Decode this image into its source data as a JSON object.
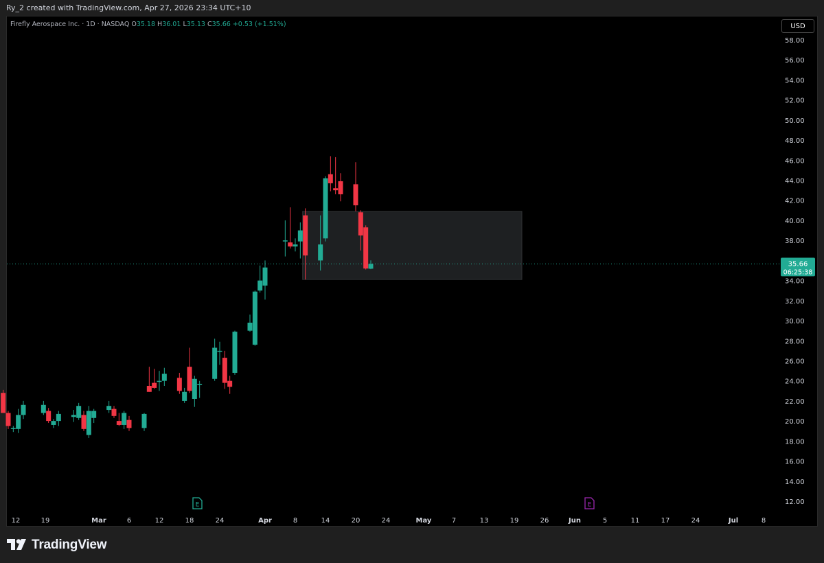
{
  "header": {
    "attribution": "Ry_2 created with TradingView.com, Apr 27, 2026 23:34 UTC+10"
  },
  "legend": {
    "symbol": "Firefly Aerospace Inc. · 1D · NASDAQ",
    "o_label": "O",
    "o": "35.18",
    "h_label": "H",
    "h": "36.01",
    "l_label": "L",
    "l": "35.13",
    "c_label": "C",
    "c": "35.66",
    "change": "+0.53 (+1.51%)"
  },
  "currency_button": "USD",
  "price_tag": {
    "price": "35.66",
    "countdown": "06:25:38"
  },
  "earnings_markers": [
    {
      "label": "E",
      "color": "#22ab94"
    },
    {
      "label": "E",
      "color": "#9c27b0"
    }
  ],
  "brand": {
    "name": "TradingView"
  },
  "colors": {
    "up": "#22ab94",
    "down": "#f23645",
    "background": "#000000",
    "price_line": "#22ab94"
  },
  "chart_data": {
    "type": "candlestick",
    "symbol": "Firefly Aerospace Inc.",
    "interval": "1D",
    "exchange": "NASDAQ",
    "ylim": [
      11,
      60
    ],
    "yticks": [
      "58.00",
      "56.00",
      "54.00",
      "52.00",
      "50.00",
      "48.00",
      "46.00",
      "44.00",
      "42.00",
      "40.00",
      "38.00",
      "36.00",
      "34.00",
      "32.00",
      "30.00",
      "28.00",
      "26.00",
      "24.00",
      "22.00",
      "20.00",
      "18.00",
      "16.00",
      "14.00",
      "12.00"
    ],
    "xticks": [
      "12",
      "19",
      "Mar",
      "6",
      "12",
      "18",
      "24",
      "Apr",
      "8",
      "14",
      "20",
      "24",
      "May",
      "7",
      "13",
      "19",
      "26",
      "Jun",
      "5",
      "11",
      "17",
      "24",
      "Jul",
      "8"
    ],
    "candles": [
      {
        "date": "2026-02-09",
        "o": 22.8,
        "h": 23.1,
        "l": 20.8,
        "c": 20.8
      },
      {
        "date": "2026-02-10",
        "o": 20.8,
        "h": 21.0,
        "l": 19.2,
        "c": 19.5
      },
      {
        "date": "2026-02-11",
        "o": 19.2,
        "h": 19.5,
        "l": 18.9,
        "c": 19.3
      },
      {
        "date": "2026-02-12",
        "o": 19.2,
        "h": 21.2,
        "l": 18.8,
        "c": 20.6
      },
      {
        "date": "2026-02-13",
        "o": 20.6,
        "h": 22.0,
        "l": 20.2,
        "c": 21.6
      },
      {
        "date": "2026-02-17",
        "o": 20.8,
        "h": 22.0,
        "l": 20.6,
        "c": 21.6
      },
      {
        "date": "2026-02-18",
        "o": 21.0,
        "h": 21.3,
        "l": 19.8,
        "c": 20.0
      },
      {
        "date": "2026-02-19",
        "o": 19.6,
        "h": 20.2,
        "l": 19.3,
        "c": 20.0
      },
      {
        "date": "2026-02-20",
        "o": 20.0,
        "h": 21.0,
        "l": 19.5,
        "c": 20.7
      },
      {
        "date": "2026-02-23",
        "o": 20.4,
        "h": 21.1,
        "l": 19.9,
        "c": 20.6
      },
      {
        "date": "2026-02-24",
        "o": 20.3,
        "h": 21.8,
        "l": 20.1,
        "c": 21.5
      },
      {
        "date": "2026-02-25",
        "o": 20.6,
        "h": 21.0,
        "l": 19.0,
        "c": 19.2
      },
      {
        "date": "2026-02-26",
        "o": 18.6,
        "h": 21.5,
        "l": 18.3,
        "c": 21.0
      },
      {
        "date": "2026-02-27",
        "o": 20.3,
        "h": 21.2,
        "l": 19.8,
        "c": 21.0
      },
      {
        "date": "2026-03-02",
        "o": 21.1,
        "h": 22.0,
        "l": 20.8,
        "c": 21.5
      },
      {
        "date": "2026-03-03",
        "o": 21.2,
        "h": 21.5,
        "l": 20.3,
        "c": 20.5
      },
      {
        "date": "2026-03-04",
        "o": 20.0,
        "h": 20.8,
        "l": 19.5,
        "c": 19.6
      },
      {
        "date": "2026-03-05",
        "o": 19.6,
        "h": 21.0,
        "l": 19.2,
        "c": 20.8
      },
      {
        "date": "2026-03-06",
        "o": 20.1,
        "h": 20.5,
        "l": 19.0,
        "c": 19.3
      },
      {
        "date": "2026-03-09",
        "o": 19.3,
        "h": 20.8,
        "l": 19.0,
        "c": 20.7
      },
      {
        "date": "2026-03-10",
        "o": 23.5,
        "h": 25.4,
        "l": 22.9,
        "c": 22.9
      },
      {
        "date": "2026-03-11",
        "o": 23.8,
        "h": 25.2,
        "l": 23.2,
        "c": 23.3
      },
      {
        "date": "2026-03-12",
        "o": 23.9,
        "h": 25.0,
        "l": 23.0,
        "c": 24.0
      },
      {
        "date": "2026-03-13",
        "o": 24.0,
        "h": 25.3,
        "l": 23.5,
        "c": 24.7
      },
      {
        "date": "2026-03-16",
        "o": 24.3,
        "h": 24.8,
        "l": 22.7,
        "c": 23.0
      },
      {
        "date": "2026-03-17",
        "o": 22.0,
        "h": 23.3,
        "l": 21.8,
        "c": 22.9
      },
      {
        "date": "2026-03-18",
        "o": 25.4,
        "h": 27.3,
        "l": 22.8,
        "c": 23.0
      },
      {
        "date": "2026-03-19",
        "o": 22.2,
        "h": 24.5,
        "l": 21.4,
        "c": 24.2
      },
      {
        "date": "2026-03-20",
        "o": 23.6,
        "h": 24.0,
        "l": 22.3,
        "c": 23.7
      },
      {
        "date": "2026-03-23",
        "o": 24.2,
        "h": 28.2,
        "l": 24.0,
        "c": 27.3
      },
      {
        "date": "2026-03-24",
        "o": 27.0,
        "h": 27.9,
        "l": 25.6,
        "c": 27.0
      },
      {
        "date": "2026-03-25",
        "o": 26.3,
        "h": 27.0,
        "l": 23.2,
        "c": 23.8
      },
      {
        "date": "2026-03-26",
        "o": 24.0,
        "h": 24.5,
        "l": 22.7,
        "c": 23.4
      },
      {
        "date": "2026-03-27",
        "o": 24.8,
        "h": 29.0,
        "l": 24.6,
        "c": 28.9
      },
      {
        "date": "2026-03-30",
        "o": 29.0,
        "h": 30.6,
        "l": 28.9,
        "c": 29.8
      },
      {
        "date": "2026-03-31",
        "o": 27.6,
        "h": 33.0,
        "l": 27.5,
        "c": 32.9
      },
      {
        "date": "2026-04-01",
        "o": 33.0,
        "h": 35.5,
        "l": 32.8,
        "c": 34.0
      },
      {
        "date": "2026-04-02",
        "o": 33.5,
        "h": 36.0,
        "l": 32.1,
        "c": 35.3
      },
      {
        "date": "2026-04-06",
        "o": 38.0,
        "h": 40.0,
        "l": 36.4,
        "c": 38.0
      },
      {
        "date": "2026-04-07",
        "o": 37.8,
        "h": 41.3,
        "l": 37.2,
        "c": 37.4
      },
      {
        "date": "2026-04-08",
        "o": 37.4,
        "h": 38.2,
        "l": 36.9,
        "c": 37.6
      },
      {
        "date": "2026-04-09",
        "o": 37.9,
        "h": 39.8,
        "l": 36.2,
        "c": 39.0
      },
      {
        "date": "2026-04-10",
        "o": 40.5,
        "h": 41.2,
        "l": 34.1,
        "c": 36.5
      },
      {
        "date": "2026-04-13",
        "o": 36.0,
        "h": 40.5,
        "l": 35.0,
        "c": 37.6
      },
      {
        "date": "2026-04-14",
        "o": 38.2,
        "h": 44.4,
        "l": 37.9,
        "c": 44.2
      },
      {
        "date": "2026-04-15",
        "o": 44.6,
        "h": 46.4,
        "l": 42.9,
        "c": 43.7
      },
      {
        "date": "2026-04-16",
        "o": 43.2,
        "h": 46.3,
        "l": 42.6,
        "c": 43.0
      },
      {
        "date": "2026-04-17",
        "o": 43.9,
        "h": 44.7,
        "l": 41.9,
        "c": 42.6
      },
      {
        "date": "2026-04-20",
        "o": 43.6,
        "h": 45.8,
        "l": 40.9,
        "c": 41.5
      },
      {
        "date": "2026-04-21",
        "o": 40.8,
        "h": 41.0,
        "l": 37.0,
        "c": 38.5
      },
      {
        "date": "2026-04-22",
        "o": 39.3,
        "h": 39.5,
        "l": 35.1,
        "c": 35.2
      },
      {
        "date": "2026-04-23",
        "o": 35.18,
        "h": 36.01,
        "l": 35.13,
        "c": 35.66
      }
    ],
    "zone": {
      "from": "2026-04-10",
      "to": "2026-05-23",
      "top": 40.9,
      "bottom": 34.1
    },
    "last_price": 35.66
  }
}
